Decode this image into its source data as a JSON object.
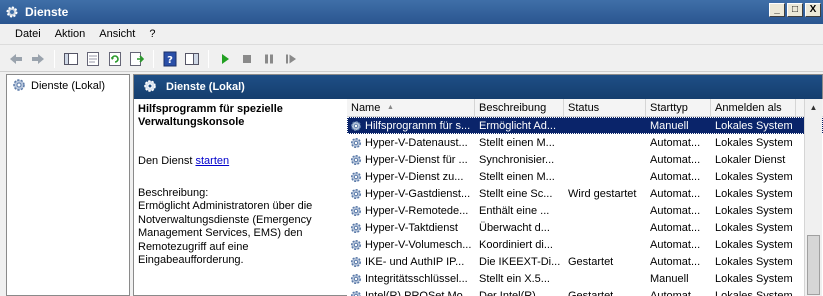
{
  "window": {
    "title": "Dienste",
    "icon": "gear-icon",
    "buttons": [
      "_",
      "□",
      "X"
    ]
  },
  "menu": [
    "Datei",
    "Aktion",
    "Ansicht",
    "?"
  ],
  "toolbar": {
    "icons": [
      "back-arrow-icon",
      "forward-arrow-icon",
      "console-tree-icon",
      "properties-icon",
      "refresh-icon",
      "export-list-icon",
      "help-icon",
      "show-hide-icon",
      "play-icon",
      "stop-icon",
      "pause-icon",
      "restart-icon"
    ]
  },
  "tree": {
    "root_label": "Dienste (Lokal)"
  },
  "main": {
    "header": "Dienste (Lokal)",
    "detail": {
      "heading": "Hilfsprogramm für spezielle Verwaltungskonsole",
      "start_prefix": "Den Dienst ",
      "start_link": "starten",
      "description_label": "Beschreibung:",
      "description": "Ermöglicht Administratoren über die Notverwaltungsdienste (Emergency Management Services, EMS) den Remotezugriff auf eine Eingabeaufforderung."
    },
    "columns": [
      "Name",
      "Beschreibung",
      "Status",
      "Starttyp",
      "Anmelden als"
    ],
    "rows": [
      {
        "name": "Hilfsprogramm für s...",
        "desc": "Ermöglicht Ad...",
        "status": "",
        "type": "Manuell",
        "login": "Lokales System",
        "selected": true
      },
      {
        "name": "Hyper-V-Datenaust...",
        "desc": "Stellt einen M...",
        "status": "",
        "type": "Automat...",
        "login": "Lokales System"
      },
      {
        "name": "Hyper-V-Dienst für ...",
        "desc": "Synchronisier...",
        "status": "",
        "type": "Automat...",
        "login": "Lokaler Dienst"
      },
      {
        "name": "Hyper-V-Dienst zu...",
        "desc": "Stellt einen M...",
        "status": "",
        "type": "Automat...",
        "login": "Lokales System"
      },
      {
        "name": "Hyper-V-Gastdienst...",
        "desc": "Stellt eine Sc...",
        "status": "Wird gestartet",
        "type": "Automat...",
        "login": "Lokales System"
      },
      {
        "name": "Hyper-V-Remotede...",
        "desc": "Enthält eine ...",
        "status": "",
        "type": "Automat...",
        "login": "Lokales System"
      },
      {
        "name": "Hyper-V-Taktdienst",
        "desc": "Überwacht d...",
        "status": "",
        "type": "Automat...",
        "login": "Lokales System"
      },
      {
        "name": "Hyper-V-Volumesch...",
        "desc": "Koordiniert di...",
        "status": "",
        "type": "Automat...",
        "login": "Lokales System"
      },
      {
        "name": "IKE- und AuthIP IP...",
        "desc": "Die IKEEXT-Di...",
        "status": "Gestartet",
        "type": "Automat...",
        "login": "Lokales System"
      },
      {
        "name": "Integritätsschlüssel...",
        "desc": "Stellt ein X.5...",
        "status": "",
        "type": "Manuell",
        "login": "Lokales System"
      },
      {
        "name": "Intel(R) PROSet Mo...",
        "desc": "Der Intel(R) ...",
        "status": "Gestartet",
        "type": "Automat...",
        "login": "Lokales System"
      }
    ]
  }
}
